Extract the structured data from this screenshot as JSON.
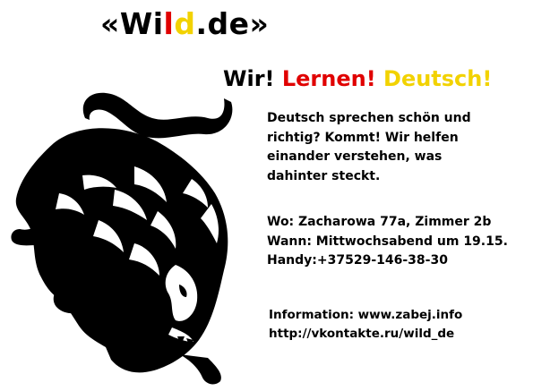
{
  "logo": {
    "open_quote": "«",
    "part1": "Wi",
    "part2": "l",
    "part3": "d",
    "part4": ".de",
    "close_quote": "»",
    "colors": {
      "black": "#000000",
      "red": "#e00000",
      "yellow": "#f2d200"
    }
  },
  "slogan": {
    "word1": "Wir!",
    "word2": "Lernen!",
    "word3": "Deutsch!",
    "colors": {
      "word1": "#000000",
      "word2": "#e00000",
      "word3": "#f2d200"
    }
  },
  "intro": {
    "lines": [
      "Deutsch sprechen schön und",
      "richtig? Kommt! Wir helfen",
      "einander verstehen, was",
      "dahinter  steckt."
    ]
  },
  "details": {
    "where": "Wo: Zacharowa 77a, Zimmer 2b",
    "when": "Wann: Mittwochsabend um 19.15.",
    "phone": "Handy:+37529-146-38-30"
  },
  "info": {
    "website": "Information: www.zabej.info",
    "vk": "http://vkontakte.ru/wild_de"
  },
  "image": {
    "icon": "lion-icon"
  }
}
